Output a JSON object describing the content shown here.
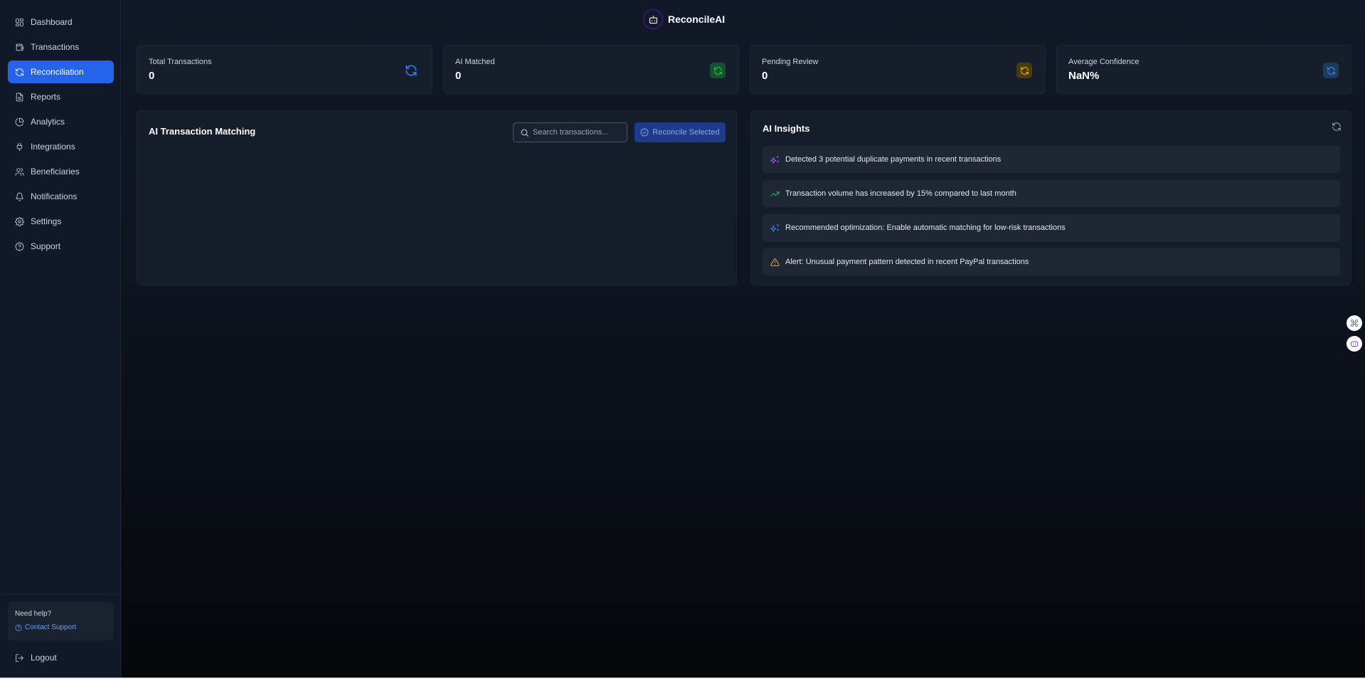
{
  "app": {
    "brand": "ReconcileAI",
    "logo_icon": "robot-icon"
  },
  "sidebar": {
    "items": [
      {
        "label": "Dashboard",
        "icon": "grid-icon",
        "active": false
      },
      {
        "label": "Transactions",
        "icon": "wallet-icon",
        "active": false
      },
      {
        "label": "Reconciliation",
        "icon": "refresh-icon",
        "active": true
      },
      {
        "label": "Reports",
        "icon": "file-icon",
        "active": false
      },
      {
        "label": "Analytics",
        "icon": "pie-chart-icon",
        "active": false
      },
      {
        "label": "Integrations",
        "icon": "plug-icon",
        "active": false
      },
      {
        "label": "Beneficiaries",
        "icon": "users-icon",
        "active": false
      },
      {
        "label": "Notifications",
        "icon": "bell-icon",
        "active": false
      },
      {
        "label": "Settings",
        "icon": "gear-icon",
        "active": false
      },
      {
        "label": "Support",
        "icon": "help-circle-icon",
        "active": false
      }
    ],
    "help": {
      "title": "Need help?",
      "contact_label": "Contact Support"
    },
    "logout_label": "Logout"
  },
  "stats": [
    {
      "label": "Total Transactions",
      "value": "0",
      "icon": "refresh-icon",
      "color": "#3b82f6",
      "bg": "transparent"
    },
    {
      "label": "AI Matched",
      "value": "0",
      "icon": "refresh-icon",
      "color": "#22c55e",
      "bg": "#14532d"
    },
    {
      "label": "Pending Review",
      "value": "0",
      "icon": "refresh-icon",
      "color": "#eab308",
      "bg": "#4a3b0b"
    },
    {
      "label": "Average Confidence",
      "value": "NaN%",
      "icon": "refresh-icon",
      "color": "#3b82f6",
      "bg": "#1e3a5f"
    }
  ],
  "matching": {
    "title": "AI Transaction Matching",
    "search_placeholder": "Search transactions...",
    "search_value": "",
    "reconcile_label": "Reconcile Selected"
  },
  "insights": {
    "title": "AI Insights",
    "items": [
      {
        "text": "Detected 3 potential duplicate payments in recent transactions",
        "icon": "sparkles-icon",
        "color": "#a855f7"
      },
      {
        "text": "Transaction volume has increased by 15% compared to last month",
        "icon": "trending-up-icon",
        "color": "#22c55e"
      },
      {
        "text": "Recommended optimization: Enable automatic matching for low-risk transactions",
        "icon": "sparkles-icon",
        "color": "#3b82f6"
      },
      {
        "text": "Alert: Unusual payment pattern detected in recent PayPal transactions",
        "icon": "alert-triangle-icon",
        "color": "#eab308"
      }
    ]
  },
  "floating": [
    {
      "icon": "command-icon",
      "color": "#6b7280"
    },
    {
      "icon": "robot-icon",
      "color": "#4f46e5"
    }
  ]
}
